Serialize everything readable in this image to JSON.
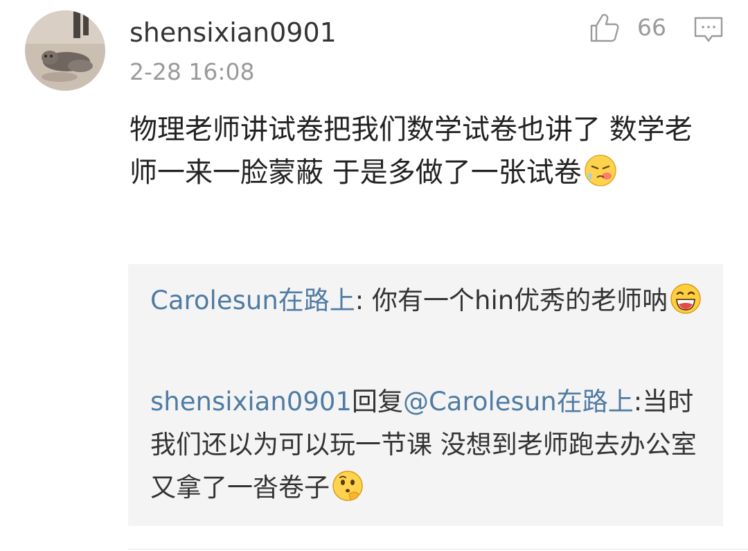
{
  "comment": {
    "user": {
      "name": "shensixian0901",
      "avatar_icon": "cat-avatar"
    },
    "timestamp": "2-28 16:08",
    "like_count": "66",
    "like_icon": "thumbs-up-icon",
    "reply_icon": "comment-bubble-icon",
    "text": "物理老师讲试卷把我们数学试卷也讲了 数学老师一来一脸蒙蔽 于是多做了一张试卷",
    "trailing_emoji": "crying-face-emoji"
  },
  "replies": [
    {
      "author": "Carolesun在路上",
      "separator": ": ",
      "text": "你有一个hin优秀的老师呐",
      "emoji": "laughing-face-emoji"
    },
    {
      "author": "shensixian0901",
      "reply_word": "回复",
      "mention": "@Carolesun在路上",
      "separator": ":",
      "text": "当时我们还以为可以玩一节课 没想到老师跑去办公室又拿了一沓卷子",
      "emoji": "thinking-face-emoji"
    }
  ],
  "colors": {
    "link": "#4f7ba4",
    "reply_background": "#f4f4f4",
    "meta_text": "#9a9a9a"
  }
}
